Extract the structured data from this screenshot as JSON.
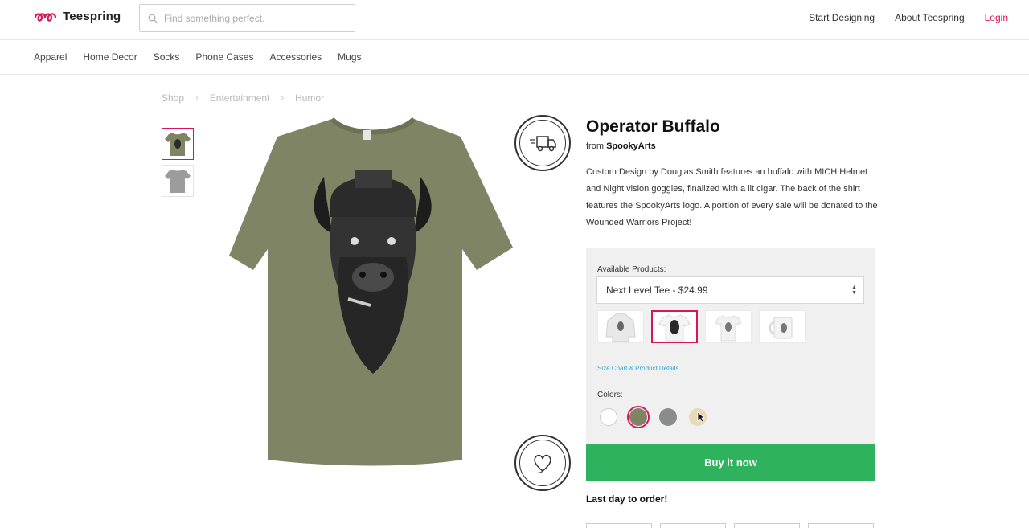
{
  "header": {
    "logo_text": "Teespring",
    "search_placeholder": "Find something perfect.",
    "nav": [
      "Start Designing",
      "About Teespring",
      "Login"
    ]
  },
  "categories": [
    "Apparel",
    "Home Decor",
    "Socks",
    "Phone Cases",
    "Accessories",
    "Mugs"
  ],
  "breadcrumb": [
    "Shop",
    "Entertainment",
    "Humor"
  ],
  "product": {
    "title": "Operator Buffalo",
    "from_label": "from",
    "seller": "SpookyArts",
    "description": "Custom Design by Douglas Smith features an buffalo with MICH Helmet and Night vision goggles, finalized with a lit cigar. The back of the shirt features the SpookyArts logo. A portion of every sale will be donated to the Wounded Warriors Project!",
    "available_label": "Available Products:",
    "selected_product": "Next Level Tee - $24.99",
    "size_link": "Size Chart & Product Details",
    "colors_label": "Colors:",
    "colors": [
      "#ffffff",
      "#7f8464",
      "#8a8c8b",
      "#e9dab5"
    ],
    "buy_label": "Buy it now",
    "last_day": "Last day to order!"
  },
  "badges": {
    "rush": "RUSH SHIPPING AVAILABLE",
    "charity": "VERIFIED CHARITY CONTRIBUTION"
  },
  "theme": {
    "accent": "#d7155d",
    "buy": "#2eb25e",
    "shirt": "#7f8464",
    "link": "#2aa7d4"
  }
}
